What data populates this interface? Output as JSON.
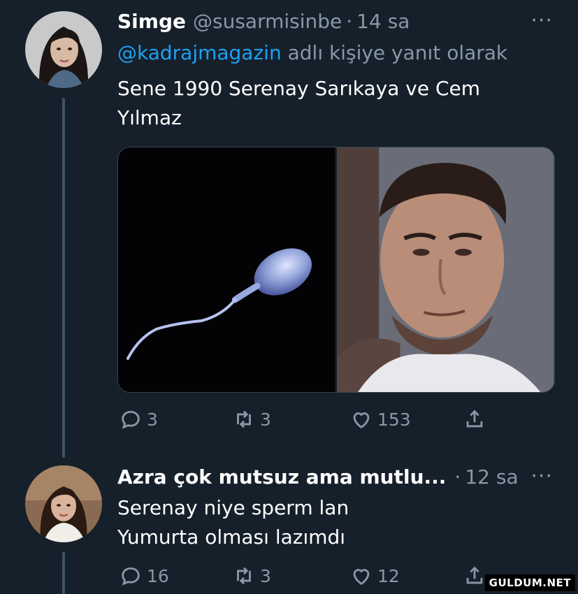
{
  "tweet1": {
    "display_name": "Simge",
    "handle": "@susarmisinbe",
    "separator": "·",
    "time": "14 sa",
    "more_icon": "more-dots-icon",
    "reply_to_handle": "@kadrajmagazin",
    "reply_to_suffix": "adlı kişiye yanıt olarak",
    "text_line1": "Sene 1990 Serenay Sarıkaya ve Cem",
    "text_line2": "Yılmaz",
    "media": {
      "left_image": "sperm-cell-image",
      "right_image": "man-portrait-image"
    },
    "actions": {
      "reply_count": "3",
      "retweet_count": "3",
      "like_count": "153"
    }
  },
  "tweet2": {
    "display_name": "Azra çok mutsuz ama mutlu...",
    "separator": "·",
    "time": "12 sa",
    "text_line1": "Serenay niye sperm lan",
    "text_line2": "Yumurta olması lazımdı",
    "actions": {
      "reply_count": "16",
      "retweet_count": "3",
      "like_count": "12"
    }
  },
  "watermark": "GULDUM.NET",
  "colors": {
    "background": "#15202b",
    "accent": "#1da1f2",
    "secondary_text": "#8899a6"
  }
}
